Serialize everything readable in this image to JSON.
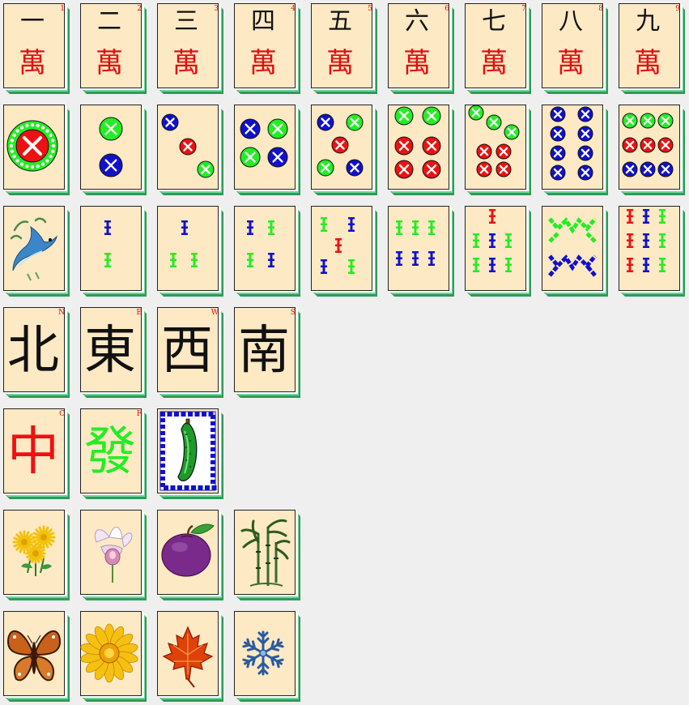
{
  "colors": {
    "background": "#efefef",
    "tile_face": "#fde9c4",
    "tile_side": "#2f9a5a",
    "tile_side_light": "#6fd69a",
    "red": "#ee1111",
    "green": "#22ee22",
    "blue": "#1111cc"
  },
  "characters": [
    {
      "num": "一",
      "wan": "萬",
      "corner": "1"
    },
    {
      "num": "二",
      "wan": "萬",
      "corner": "2"
    },
    {
      "num": "三",
      "wan": "萬",
      "corner": "3"
    },
    {
      "num": "四",
      "wan": "萬",
      "corner": "4"
    },
    {
      "num": "五",
      "wan": "萬",
      "corner": "5"
    },
    {
      "num": "六",
      "wan": "萬",
      "corner": "6"
    },
    {
      "num": "七",
      "wan": "萬",
      "corner": "7"
    },
    {
      "num": "八",
      "wan": "萬",
      "corner": "8"
    },
    {
      "num": "九",
      "wan": "萬",
      "corner": "9"
    }
  ],
  "circles": [
    1,
    2,
    3,
    4,
    5,
    6,
    7,
    8,
    9
  ],
  "bamboos": [
    {
      "value": 1,
      "icon": "bird-icon"
    },
    {
      "value": 2
    },
    {
      "value": 3
    },
    {
      "value": 4
    },
    {
      "value": 5
    },
    {
      "value": 6
    },
    {
      "value": 7
    },
    {
      "value": 8
    },
    {
      "value": 9
    }
  ],
  "winds": [
    {
      "char": "北",
      "corner": "N"
    },
    {
      "char": "東",
      "corner": "E"
    },
    {
      "char": "西",
      "corner": "W"
    },
    {
      "char": "南",
      "corner": "S"
    }
  ],
  "dragons": [
    {
      "char": "中",
      "corner": "C",
      "color": "#ee1111"
    },
    {
      "char": "發",
      "corner": "F",
      "color": "#22ee22"
    },
    {
      "icon": "pickle-icon"
    }
  ],
  "flowers": [
    {
      "icon": "chrysanthemum-icon"
    },
    {
      "icon": "orchid-icon"
    },
    {
      "icon": "plum-icon"
    },
    {
      "icon": "bamboo-plant-icon"
    }
  ],
  "seasons": [
    {
      "icon": "butterfly-icon"
    },
    {
      "icon": "sunflower-icon"
    },
    {
      "icon": "maple-leaf-icon"
    },
    {
      "icon": "snowflake-icon"
    }
  ]
}
